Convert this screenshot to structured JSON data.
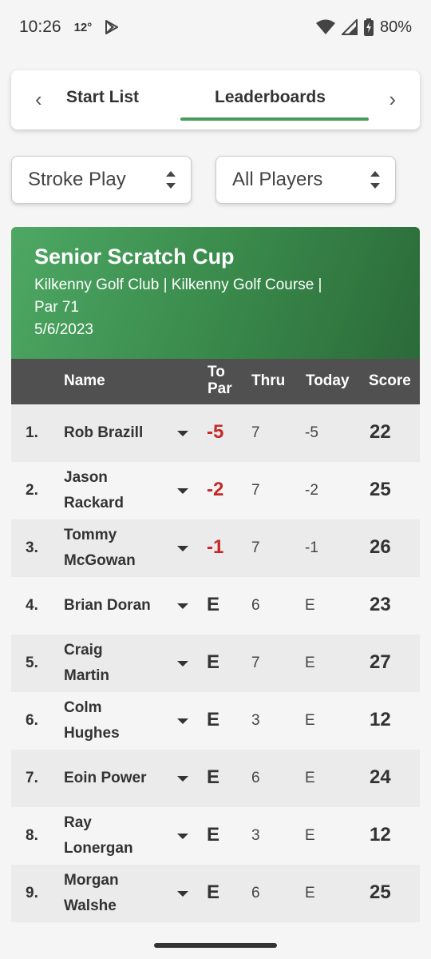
{
  "status_bar": {
    "time": "10:26",
    "temperature": "12°",
    "battery": "80%",
    "icons": [
      "play-store-icon",
      "wifi-icon",
      "signal-icon",
      "battery-icon"
    ]
  },
  "tabs": {
    "prev_label": "‹",
    "next_label": "›",
    "items": [
      {
        "label": "Start List",
        "active": false
      },
      {
        "label": "Leaderboards",
        "active": true
      }
    ],
    "accent_color": "#4a9c5a"
  },
  "filters": {
    "format": {
      "value": "Stroke Play"
    },
    "players": {
      "value": "All Players"
    }
  },
  "event": {
    "title": "Senior Scratch Cup",
    "venue_line": "Kilkenny Golf Club  |  Kilkenny Golf Course  |",
    "par": " Par 71",
    "date": "5/6/2023",
    "banner_colors": [
      "#4ea864",
      "#2b6a39"
    ]
  },
  "table": {
    "headers": {
      "name": "Name",
      "to_par_1": "To",
      "to_par_2": "Par",
      "thru": "Thru",
      "today": "Today",
      "score": "Score"
    },
    "under_par_color": "#c62828",
    "rows": [
      {
        "pos": "1.",
        "name_1": "Rob Brazill",
        "name_2": "",
        "to_par": "-5",
        "thru": "7",
        "today": "-5",
        "score": "22"
      },
      {
        "pos": "2.",
        "name_1": "Jason",
        "name_2": "Rackard",
        "to_par": "-2",
        "thru": "7",
        "today": "-2",
        "score": "25"
      },
      {
        "pos": "3.",
        "name_1": "Tommy",
        "name_2": "McGowan",
        "to_par": "-1",
        "thru": "7",
        "today": "-1",
        "score": "26"
      },
      {
        "pos": "4.",
        "name_1": "Brian Doran",
        "name_2": "",
        "to_par": "E",
        "thru": "6",
        "today": "E",
        "score": "23"
      },
      {
        "pos": "5.",
        "name_1": "Craig",
        "name_2": "Martin",
        "to_par": "E",
        "thru": "7",
        "today": "E",
        "score": "27"
      },
      {
        "pos": "6.",
        "name_1": "Colm",
        "name_2": "Hughes",
        "to_par": "E",
        "thru": "3",
        "today": "E",
        "score": "12"
      },
      {
        "pos": "7.",
        "name_1": "Eoin Power",
        "name_2": "",
        "to_par": "E",
        "thru": "6",
        "today": "E",
        "score": "24"
      },
      {
        "pos": "8.",
        "name_1": "Ray",
        "name_2": "Lonergan",
        "to_par": "E",
        "thru": "3",
        "today": "E",
        "score": "12"
      },
      {
        "pos": "9.",
        "name_1": "Morgan",
        "name_2": "Walshe",
        "to_par": "E",
        "thru": "6",
        "today": "E",
        "score": "25"
      }
    ]
  }
}
